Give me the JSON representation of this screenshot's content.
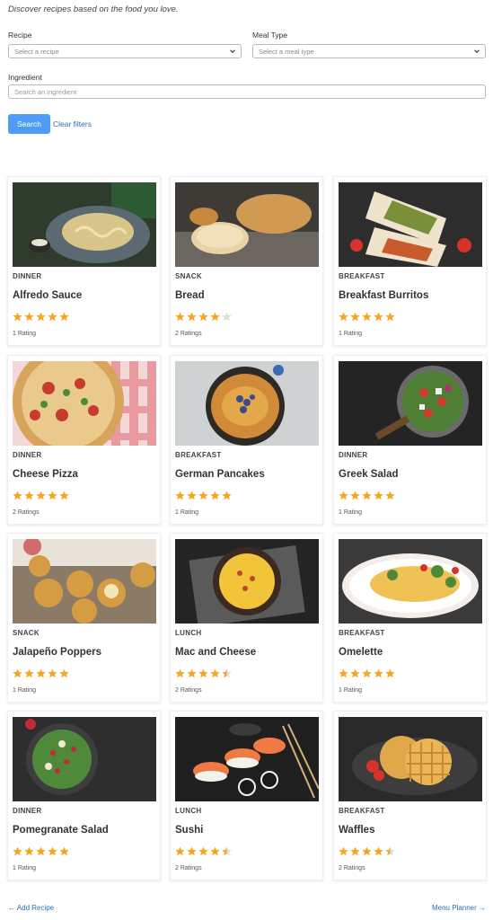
{
  "intro": "Discover recipes based on the food you love.",
  "filters": {
    "recipe_label": "Recipe",
    "recipe_placeholder": "Select a recipe",
    "meal_label": "Meal Type",
    "meal_placeholder": "Select a meal type",
    "ingredient_label": "Ingredient",
    "ingredient_placeholder": "Search an ingredient",
    "search_button": "Search",
    "clear_link": "Clear filters"
  },
  "colors": {
    "accent": "#4f9cf7",
    "link": "#2a6fb5",
    "star": "#f5a623",
    "star_empty": "#dddddd"
  },
  "recipes": [
    {
      "category": "DINNER",
      "title": "Alfredo Sauce",
      "rating": 5,
      "ratings_text": "1 Rating"
    },
    {
      "category": "SNACK",
      "title": "Bread",
      "rating": 4,
      "ratings_text": "2 Ratings"
    },
    {
      "category": "BREAKFAST",
      "title": "Breakfast Burritos",
      "rating": 5,
      "ratings_text": "1 Rating"
    },
    {
      "category": "DINNER",
      "title": "Cheese Pizza",
      "rating": 5,
      "ratings_text": "2 Ratings"
    },
    {
      "category": "BREAKFAST",
      "title": "German Pancakes",
      "rating": 5,
      "ratings_text": "1 Rating"
    },
    {
      "category": "DINNER",
      "title": "Greek Salad",
      "rating": 5,
      "ratings_text": "1 Rating"
    },
    {
      "category": "SNACK",
      "title": "Jalapeño Poppers",
      "rating": 5,
      "ratings_text": "1 Rating"
    },
    {
      "category": "LUNCH",
      "title": "Mac and Cheese",
      "rating": 4.5,
      "ratings_text": "2 Ratings"
    },
    {
      "category": "BREAKFAST",
      "title": "Omelette",
      "rating": 5,
      "ratings_text": "1 Rating"
    },
    {
      "category": "DINNER",
      "title": "Pomegranate Salad",
      "rating": 5,
      "ratings_text": "1 Rating"
    },
    {
      "category": "LUNCH",
      "title": "Sushi",
      "rating": 4.5,
      "ratings_text": "2 Ratings"
    },
    {
      "category": "BREAKFAST",
      "title": "Waffles",
      "rating": 4.5,
      "ratings_text": "2 Ratings"
    }
  ],
  "footer": {
    "add_recipe": "← Add Recipe",
    "menu_planner": "Menu Planner →"
  }
}
